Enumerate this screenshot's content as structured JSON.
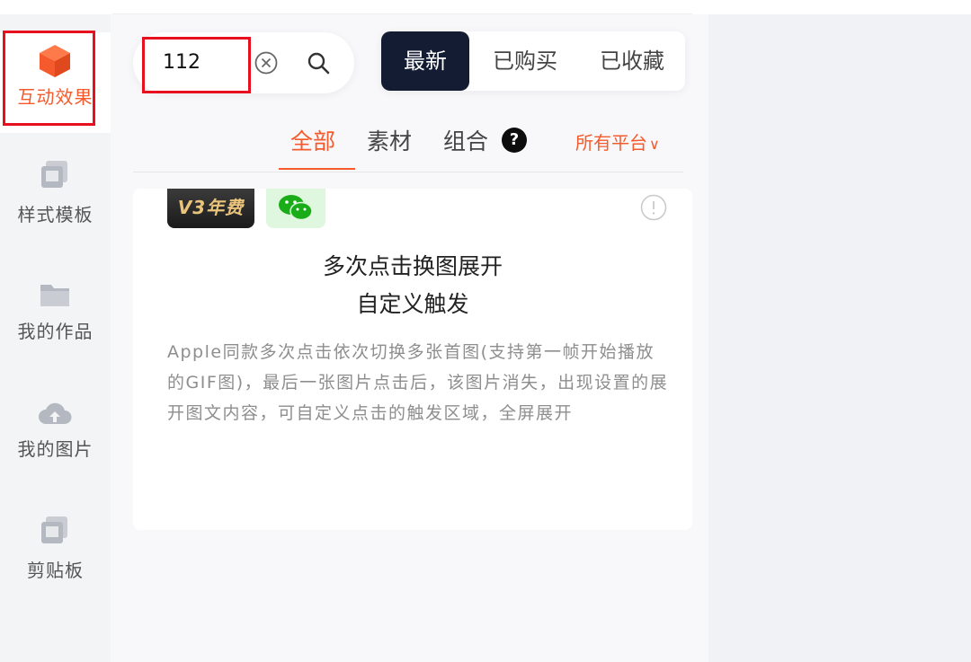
{
  "sidebar": {
    "items": [
      {
        "label": "互动效果",
        "icon": "cube-icon",
        "active": true
      },
      {
        "label": "样式模板",
        "icon": "template-icon"
      },
      {
        "label": "我的作品",
        "icon": "folder-icon"
      },
      {
        "label": "我的图片",
        "icon": "cloud-upload-icon"
      },
      {
        "label": "剪贴板",
        "icon": "clipboard-icon"
      }
    ]
  },
  "search": {
    "value": "112",
    "clear_icon": "clear-circle-icon",
    "search_icon": "search-icon"
  },
  "segment": {
    "items": [
      "最新",
      "已购买",
      "已收藏"
    ],
    "active": "最新"
  },
  "tabs": {
    "items": [
      "全部",
      "素材",
      "组合"
    ],
    "active": "全部",
    "help_label": "?"
  },
  "platform": {
    "label": "所有平台",
    "chevron": "∨"
  },
  "card": {
    "badge_v3": "V3年费",
    "badge_platform_icon": "wechat-icon",
    "title_line1": "多次点击换图展开",
    "title_line2": "自定义触发",
    "description": "Apple同款多次点击依次切换多张首图(支持第一帧开始播放的GIF图)，最后一张图片点击后，该图片消失，出现设置的展开图文内容，可自定义点击的触发区域，全屏展开"
  },
  "colors": {
    "accent": "#f55a2c",
    "dark": "#141c33",
    "highlight": "#e8101f"
  }
}
